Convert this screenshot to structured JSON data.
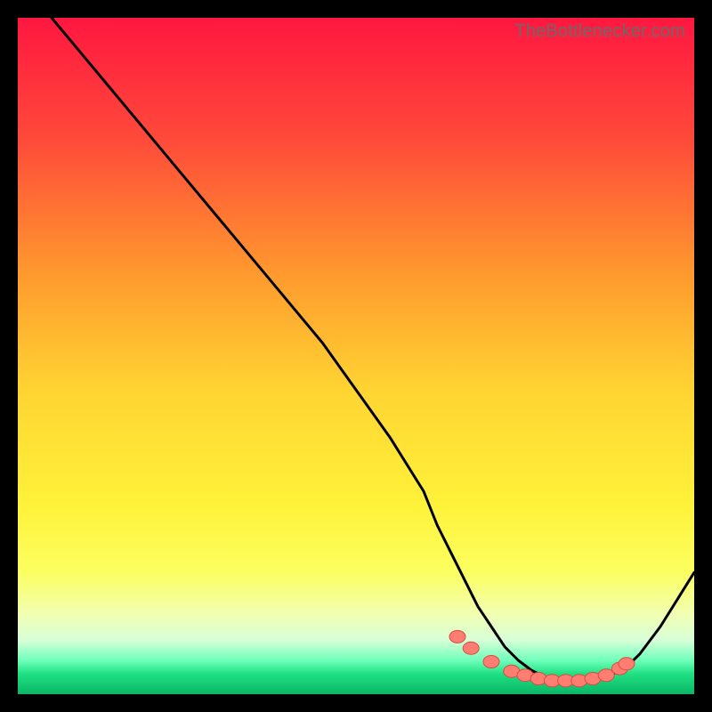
{
  "watermark": "TheBottlenecker.com",
  "colors": {
    "gradient_top": "#ff1740",
    "gradient_mid_upper": "#ff7a2a",
    "gradient_mid": "#ffe83a",
    "gradient_mid_lower": "#f7ff8a",
    "gradient_band": "#efffd0",
    "gradient_green": "#19e07a",
    "gradient_green_deep": "#0dbf6a",
    "curve": "#000000",
    "marker_fill": "#ff7e71",
    "marker_stroke": "#d94b42"
  },
  "chart_data": {
    "type": "line",
    "title": "",
    "xlabel": "",
    "ylabel": "",
    "xlim": [
      0,
      100
    ],
    "ylim": [
      0,
      100
    ],
    "series": [
      {
        "name": "bottleneck-curve",
        "x": [
          5,
          10,
          15,
          20,
          25,
          30,
          35,
          40,
          45,
          50,
          55,
          60,
          62,
          65,
          68,
          70,
          72,
          74,
          76,
          78,
          80,
          82,
          84,
          86,
          88,
          90,
          92,
          95,
          100
        ],
        "y": [
          100,
          94,
          88,
          82,
          76,
          70,
          64,
          58,
          52,
          45,
          38,
          30,
          25,
          19,
          13,
          10,
          7,
          5,
          3.5,
          2.5,
          2,
          2,
          2,
          2.3,
          3,
          4,
          6,
          10,
          18
        ]
      }
    ],
    "markers": {
      "name": "optimal-range",
      "x": [
        65,
        67,
        70,
        73,
        75,
        77,
        79,
        81,
        83,
        85,
        87,
        89,
        90
      ],
      "y": [
        8.5,
        6.8,
        4.8,
        3.4,
        2.8,
        2.3,
        2.0,
        2.0,
        2.0,
        2.3,
        2.8,
        3.8,
        4.5
      ]
    }
  }
}
